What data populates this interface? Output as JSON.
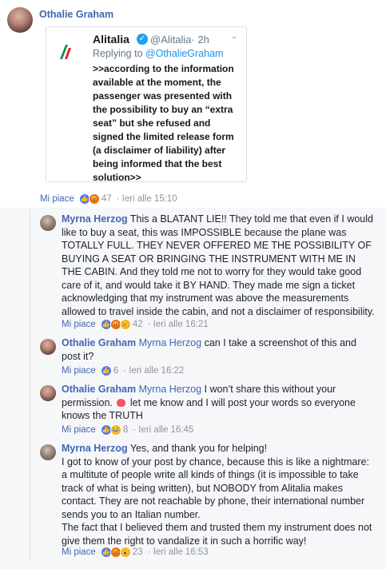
{
  "post": {
    "author": "Othalie Graham",
    "tweet": {
      "name": "Alitalia",
      "handle": "@Alitalia",
      "age": "· 2h",
      "reply_prefix": "Replying to ",
      "reply_to": "@OthalieGraham",
      "body": ">>according to the information available at the moment, the passenger was presented with the possibility to buy an “extra seat” but she refused and signed the limited release form (a disclaimer of liability) after being informed that the best solution>>"
    },
    "like_label": "Mi piace",
    "reaction_count": "47",
    "timestamp": "Ieri alle 15:10"
  },
  "replies": [
    {
      "author": "Myrna Herzog",
      "tag": "",
      "text": "This a BLATANT LIE!! They told me that even if I would like to buy a seat, this was IMPOSSIBLE because the plane was TOTALLY FULL. THEY NEVER OFFERED ME THE POSSIBILITY OF BUYING A SEAT OR BRINGING THE INSTRUMENT WITH ME IN THE CABIN. And they told me not to worry for they would take good care of it, and would take it BY HAND. They made me sign a ticket acknowledging that my instrument was above the measurements allowed to travel inside the cabin, and not a disclaimer of responsibility.",
      "like_label": "Mi piace",
      "count": "42",
      "timestamp": "Ieri alle 16:21"
    },
    {
      "author": "Othalie Graham",
      "tag": "Myrna Herzog",
      "text": "can I take a screenshot of this and post it?",
      "like_label": "Mi piace",
      "count": "6",
      "timestamp": "Ieri alle 16:22"
    },
    {
      "author": "Othalie Graham",
      "tag": "Myrna Herzog",
      "text_before": "I won’t share this without your permission.",
      "text_after": "let me know and I will post your words so everyone knows the TRUTH",
      "like_label": "Mi piace",
      "count": "8",
      "timestamp": "Ieri alle 16:45"
    },
    {
      "author": "Myrna Herzog",
      "tag": "",
      "text": "Yes, and thank you for helping!",
      "text2": "I got to know of your post by chance, because this is like a nightmare: a multitute of people write all kinds of things (it is impossible to take track of what is being written), but NOBODY from Alitalia makes contact. They are not reachable by phone, their international number sends you to an Italian number.",
      "text3": "The fact that I believed them and trusted them my instrument does not give them the right to vandalize it in such a horrific way!",
      "like_label": "Mi piace",
      "count": "23",
      "timestamp": "Ieri alle 16:53"
    }
  ]
}
